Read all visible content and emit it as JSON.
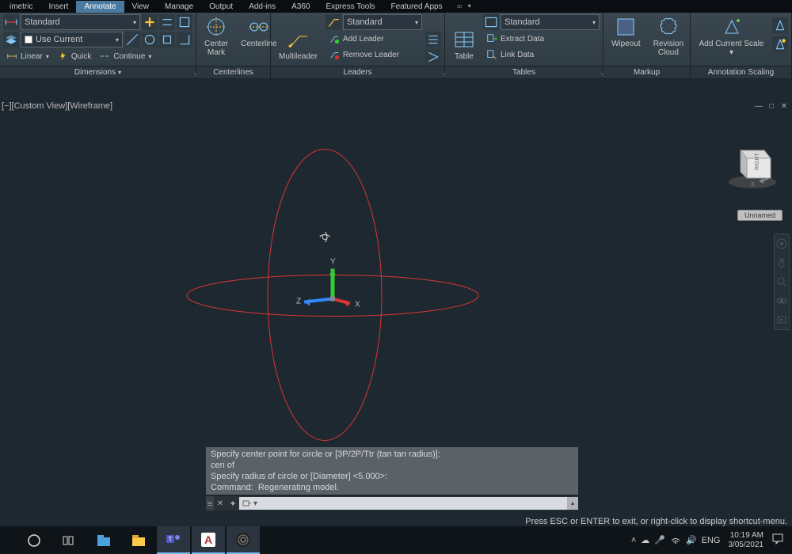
{
  "menu": {
    "items": [
      "imetric",
      "Insert",
      "Annotate",
      "View",
      "Manage",
      "Output",
      "Add-ins",
      "A360",
      "Express Tools",
      "Featured Apps"
    ],
    "active_index": 2
  },
  "ribbon": {
    "dimensions": {
      "style": "Standard",
      "layer": "Use Current",
      "linear": "Linear",
      "quick": "Quick",
      "continue": "Continue",
      "title": "Dimensions"
    },
    "centerlines": {
      "center_mark": "Center Mark",
      "centerline": "Centerline",
      "title": "Centerlines"
    },
    "leaders": {
      "style": "Standard",
      "multileader": "Multileader",
      "add": "Add Leader",
      "remove": "Remove Leader",
      "title": "Leaders"
    },
    "tables": {
      "style": "Standard",
      "table": "Table",
      "extract": "Extract Data",
      "link": "Link Data",
      "title": "Tables"
    },
    "markup": {
      "wipeout": "Wipeout",
      "revcloud": "Revision Cloud",
      "title": "Markup"
    },
    "scaling": {
      "addscale": "Add Current Scale",
      "title": "Annotation Scaling"
    }
  },
  "viewport": {
    "label": "[−][Custom View][Wireframe]",
    "unnamed": "Unnamed",
    "viewcube_face": "RIGHT"
  },
  "command": {
    "history": [
      "Specify center point for circle or [3P/2P/Ttr (tan tan radius)]:",
      "cen of",
      "Specify radius of circle or [Diameter] <5.000>:",
      "Command:  Regenerating model."
    ],
    "hint": "Press ESC or ENTER to exit, or right-click to display shortcut-menu."
  },
  "taskbar": {
    "lang": "ENG",
    "time": "10:19 AM",
    "date": "3/05/2021"
  },
  "ucs": {
    "x": "X",
    "y": "Y",
    "z": "Z"
  }
}
